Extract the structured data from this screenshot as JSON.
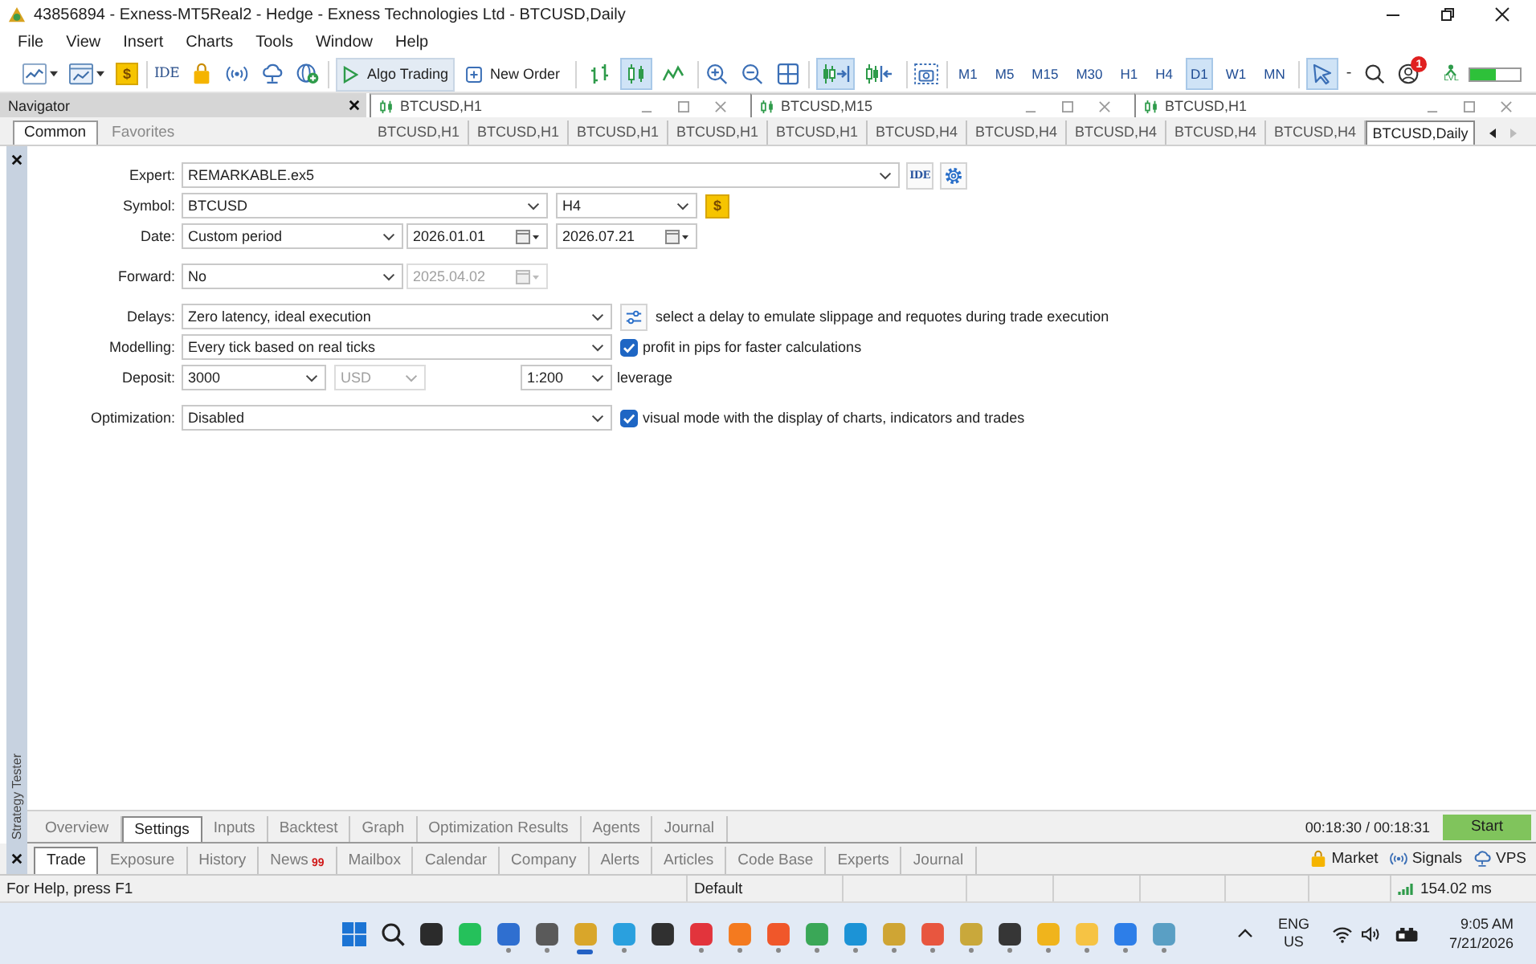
{
  "window": {
    "title": "43856894 - Exness-MT5Real2 - Hedge - Exness Technologies Ltd - BTCUSD,Daily"
  },
  "menu": [
    "File",
    "View",
    "Insert",
    "Charts",
    "Tools",
    "Window",
    "Help"
  ],
  "toolbar": {
    "dollar": "$",
    "ide": "IDE",
    "algo_trading": {
      "label": "Algo Trading",
      "on": true
    },
    "new_order": "New Order",
    "chart_types": [
      {
        "selected": false
      },
      {
        "selected": true
      },
      {
        "selected": false
      }
    ],
    "auto_scroll": {
      "selected": true
    },
    "chart_shift": {
      "selected": false
    },
    "timeframes": [
      {
        "label": "M1",
        "selected": false
      },
      {
        "label": "M5",
        "selected": false
      },
      {
        "label": "M15",
        "selected": false
      },
      {
        "label": "M30",
        "selected": false
      },
      {
        "label": "H1",
        "selected": false
      },
      {
        "label": "H4",
        "selected": false
      },
      {
        "label": "D1",
        "selected": true
      },
      {
        "label": "W1",
        "selected": false
      },
      {
        "label": "MN",
        "selected": false
      }
    ],
    "cursor": {
      "selected": true
    },
    "cursor_menu": "-",
    "notifications": "1",
    "level_label": "LVL",
    "meter": {
      "level": 0.5
    }
  },
  "navigator": {
    "title": "Navigator",
    "tabs": [
      {
        "label": "Common",
        "selected": true
      },
      {
        "label": "Favorites",
        "selected": false
      }
    ]
  },
  "chart_windows": [
    {
      "title": "BTCUSD,H1"
    },
    {
      "title": "BTCUSD,M15"
    },
    {
      "title": "BTCUSD,H1"
    }
  ],
  "chart_tabs": [
    {
      "label": "BTCUSD,H1",
      "selected": false
    },
    {
      "label": "BTCUSD,H1",
      "selected": false
    },
    {
      "label": "BTCUSD,H1",
      "selected": false
    },
    {
      "label": "BTCUSD,H1",
      "selected": false
    },
    {
      "label": "BTCUSD,H1",
      "selected": false
    },
    {
      "label": "BTCUSD,H4",
      "selected": false
    },
    {
      "label": "BTCUSD,H4",
      "selected": false
    },
    {
      "label": "BTCUSD,H4",
      "selected": false
    },
    {
      "label": "BTCUSD,H4",
      "selected": false
    },
    {
      "label": "BTCUSD,H4",
      "selected": false
    },
    {
      "label": "BTCUSD,Daily",
      "selected": true
    }
  ],
  "tester": {
    "side_label": "Strategy Tester",
    "expert": {
      "label": "Expert:",
      "value": "REMARKABLE.ex5",
      "ide": "IDE"
    },
    "symbol": {
      "label": "Symbol:",
      "value": "BTCUSD",
      "timeframe": "H4",
      "dollar": "$"
    },
    "date": {
      "label": "Date:",
      "mode": "Custom period",
      "from": "2026.01.01",
      "to": "2026.07.21"
    },
    "forward": {
      "label": "Forward:",
      "mode": "No",
      "date": {
        "value": "2025.04.02",
        "disabled": true
      }
    },
    "delays": {
      "label": "Delays:",
      "value": "Zero latency, ideal execution",
      "hint": "select a delay to emulate slippage and requotes during trade execution"
    },
    "modelling": {
      "label": "Modelling:",
      "value": "Every tick based on real ticks",
      "option": {
        "label": "profit in pips for faster calculations",
        "checked": true
      }
    },
    "deposit": {
      "label": "Deposit:",
      "value": "3000",
      "currency": {
        "value": "USD",
        "disabled": true
      },
      "leverage": "1:200",
      "leverage_label": "leverage"
    },
    "optimization": {
      "label": "Optimization:",
      "value": "Disabled",
      "option": {
        "label": "visual mode with the display of charts, indicators and trades",
        "checked": true
      }
    },
    "tabs": [
      {
        "label": "Overview",
        "selected": false
      },
      {
        "label": "Settings",
        "selected": true
      },
      {
        "label": "Inputs",
        "selected": false
      },
      {
        "label": "Backtest",
        "selected": false
      },
      {
        "label": "Graph",
        "selected": false
      },
      {
        "label": "Optimization Results",
        "selected": false
      },
      {
        "label": "Agents",
        "selected": false
      },
      {
        "label": "Journal",
        "selected": false
      }
    ],
    "timer": "00:18:30 / 00:18:31",
    "start": "Start"
  },
  "toolbox": {
    "tabs": [
      {
        "label": "Trade",
        "selected": true
      },
      {
        "label": "Exposure",
        "selected": false
      },
      {
        "label": "History",
        "selected": false
      },
      {
        "label": "News",
        "badge": "99",
        "selected": false
      },
      {
        "label": "Mailbox",
        "selected": false
      },
      {
        "label": "Calendar",
        "selected": false
      },
      {
        "label": "Company",
        "selected": false
      },
      {
        "label": "Alerts",
        "selected": false
      },
      {
        "label": "Articles",
        "selected": false
      },
      {
        "label": "Code Base",
        "selected": false
      },
      {
        "label": "Experts",
        "selected": false
      },
      {
        "label": "Journal",
        "selected": false
      }
    ],
    "links": [
      {
        "kind": "bag",
        "label": "Market"
      },
      {
        "kind": "radio",
        "label": "Signals"
      },
      {
        "kind": "cloud",
        "label": "VPS"
      }
    ]
  },
  "status_bar": {
    "help": "For Help, press F1",
    "profile": "Default",
    "ping": "154.02 ms"
  },
  "taskbar": {
    "apps": [
      {
        "kind": "start",
        "running": false,
        "active": false
      },
      {
        "kind": "search",
        "running": false,
        "active": false
      },
      {
        "kind": "tile",
        "color": "#2b2b2b",
        "running": false,
        "active": false
      },
      {
        "kind": "tile",
        "color": "#25c15b",
        "running": false,
        "active": false
      },
      {
        "kind": "tile",
        "color": "#2f6fd0",
        "running": true,
        "active": false
      },
      {
        "kind": "tile",
        "color": "#5a5a5a",
        "running": true,
        "active": false
      },
      {
        "kind": "tile",
        "color": "#d9a62a",
        "running": true,
        "active": true
      },
      {
        "kind": "tile",
        "color": "#2aa0de",
        "running": true,
        "active": false
      },
      {
        "kind": "tile",
        "color": "#303030",
        "running": false,
        "active": false
      },
      {
        "kind": "tile",
        "color": "#e2343c",
        "running": true,
        "active": false
      },
      {
        "kind": "tile",
        "color": "#f47a1f",
        "running": true,
        "active": false
      },
      {
        "kind": "tile",
        "color": "#f0572a",
        "running": true,
        "active": false
      },
      {
        "kind": "tile",
        "color": "#3aa757",
        "running": true,
        "active": false
      },
      {
        "kind": "tile",
        "color": "#1c93d6",
        "running": true,
        "active": false
      },
      {
        "kind": "tile",
        "color": "#cfa534",
        "running": true,
        "active": false
      },
      {
        "kind": "tile",
        "color": "#e8563f",
        "running": true,
        "active": false
      },
      {
        "kind": "tile",
        "color": "#c9a83b",
        "running": true,
        "active": false
      },
      {
        "kind": "tile",
        "color": "#363636",
        "running": true,
        "active": false
      },
      {
        "kind": "tile",
        "color": "#f0b41c",
        "running": true,
        "active": false
      },
      {
        "kind": "tile",
        "color": "#f6c344",
        "running": true,
        "active": false
      },
      {
        "kind": "tile",
        "color": "#2d7ee8",
        "running": true,
        "active": false
      },
      {
        "kind": "tile",
        "color": "#5a9fc4",
        "running": true,
        "active": false
      }
    ],
    "language": "ENG",
    "region": "US",
    "time": "9:05 AM",
    "date": "7/21/2026"
  }
}
